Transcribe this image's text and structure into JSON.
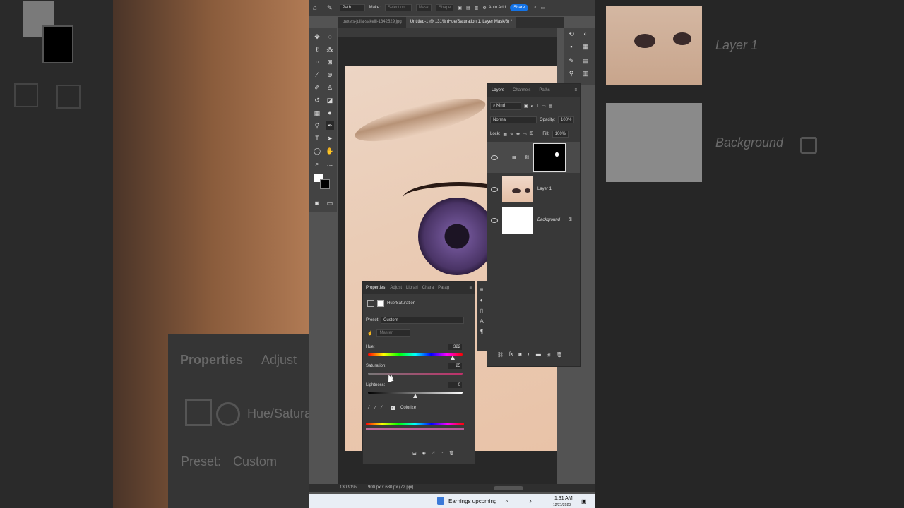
{
  "optionsBar": {
    "mode_label": "Path",
    "make_label": "Make:",
    "selection_label": "Selection...",
    "mask_label": "Mask",
    "shape_label": "Shape",
    "auto_add_label": "Auto Add",
    "share_label": "Share"
  },
  "tabs": [
    {
      "label": "pexels-julia-sakelli-1342529.jpg"
    },
    {
      "label": "Untitled-1 @ 131% (Hue/Saturation 1, Layer Mask/8) *"
    }
  ],
  "layers": {
    "tabs": [
      "Layers",
      "Channels",
      "Paths"
    ],
    "kind_label": "Kind",
    "blend_mode": "Normal",
    "opacity_label": "Opacity:",
    "opacity_value": "100%",
    "lock_label": "Lock:",
    "fill_label": "Fill:",
    "fill_value": "100%",
    "items": [
      {
        "name": "",
        "type": "adjustment"
      },
      {
        "name": "Layer 1",
        "type": "image"
      },
      {
        "name": "Background",
        "type": "background"
      }
    ]
  },
  "properties": {
    "tabs": [
      "Properties",
      "Adjust",
      "Librari",
      "Chara",
      "Parag"
    ],
    "title": "Hue/Saturation",
    "preset_label": "Preset:",
    "preset_value": "Custom",
    "channel_value": "Master",
    "hue_label": "Hue:",
    "hue_value": "322",
    "saturation_label": "Saturation:",
    "saturation_value": "25",
    "lightness_label": "Lightness:",
    "lightness_value": "0",
    "colorize_label": "Colorize",
    "colorize_checked": true
  },
  "status": {
    "zoom": "130.91%",
    "doc_size": "900 px x 680 px (72 ppi)"
  },
  "taskbar": {
    "news": "Earnings upcoming",
    "time": "1:31 AM",
    "date": "12/21/2023"
  },
  "ghost": {
    "layer1": "Layer 1",
    "background": "Background",
    "properties": "Properties",
    "adjust": "Adjust",
    "huesat": "Hue/Satura",
    "preset": "Preset:",
    "custom": "Custom"
  }
}
